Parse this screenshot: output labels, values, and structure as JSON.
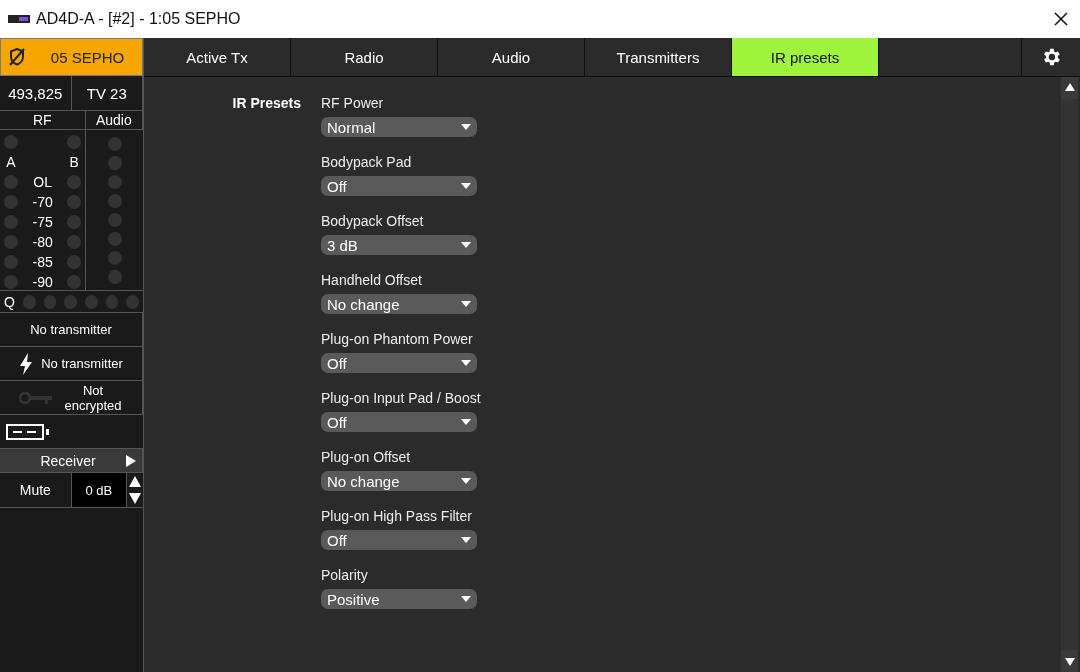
{
  "window": {
    "title": "AD4D-A - [#2] - 1:05 SEPHO"
  },
  "channel": {
    "name": "05 SEPHO",
    "frequency": "493,825",
    "tv_channel": "TV 23",
    "meter_headers": [
      "RF",
      "Audio"
    ],
    "antenna_labels": [
      "A",
      "B"
    ],
    "rf_scale": [
      "OL",
      "-70",
      "-75",
      "-80",
      "-85",
      "-90"
    ],
    "quality_label": "Q",
    "transmitter": "No transmitter",
    "battery_text": "No transmitter",
    "encryption": "Not encrypted",
    "receiver_button": "Receiver",
    "mute_button": "Mute",
    "gain": "0 dB"
  },
  "tabs": [
    {
      "label": "Active Tx",
      "selected": false
    },
    {
      "label": "Radio",
      "selected": false
    },
    {
      "label": "Audio",
      "selected": false
    },
    {
      "label": "Transmitters",
      "selected": false
    },
    {
      "label": "IR presets",
      "selected": true
    }
  ],
  "section_title": "IR Presets",
  "settings": [
    {
      "label": "RF Power",
      "value": "Normal"
    },
    {
      "label": "Bodypack Pad",
      "value": "Off"
    },
    {
      "label": "Bodypack Offset",
      "value": "3 dB"
    },
    {
      "label": "Handheld Offset",
      "value": "No change"
    },
    {
      "label": "Plug-on Phantom Power",
      "value": "Off"
    },
    {
      "label": "Plug-on Input Pad / Boost",
      "value": "Off"
    },
    {
      "label": "Plug-on Offset",
      "value": "No change"
    },
    {
      "label": "Plug-on High Pass Filter",
      "value": "Off"
    },
    {
      "label": "Polarity",
      "value": "Positive"
    }
  ]
}
